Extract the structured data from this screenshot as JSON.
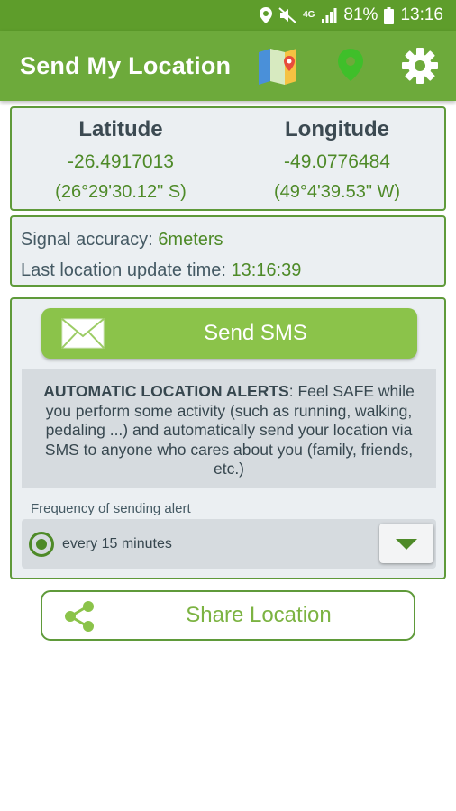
{
  "status_bar": {
    "network": "4G",
    "battery": "81%",
    "time": "13:16",
    "icons": [
      "location-icon",
      "mute-icon",
      "network-icon",
      "signal-icon",
      "battery-icon"
    ]
  },
  "app_bar": {
    "title": "Send My Location",
    "icons": [
      "map-icon",
      "location-pin-icon",
      "settings-gear-icon"
    ]
  },
  "coordinates": {
    "latitude": {
      "label": "Latitude",
      "decimal": "-26.4917013",
      "dms": "(26°29'30.12\" S)"
    },
    "longitude": {
      "label": "Longitude",
      "decimal": "-49.0776484",
      "dms": "(49°4'39.53\" W)"
    }
  },
  "info": {
    "accuracy_label": "Signal accuracy:",
    "accuracy_value": "6meters",
    "update_label": "Last location update time:",
    "update_value": "13:16:39"
  },
  "sms_button": {
    "label": "Send SMS",
    "icon": "envelope-icon"
  },
  "alerts": {
    "title": "AUTOMATIC LOCATION ALERTS",
    "text": ": Feel SAFE while you perform some activity (such as running, walking, pedaling ...) and automatically send your location via SMS to anyone who cares about you (family, friends, etc.)"
  },
  "frequency": {
    "label": "Frequency of sending alert",
    "selected": "every 15 minutes"
  },
  "share_button": {
    "label": "Share Location",
    "icon": "share-icon"
  },
  "colors": {
    "status_bar": "#5e9d2b",
    "app_bar": "#6daa3b",
    "accent_green": "#4e8a28",
    "sms_button": "#8bc34a",
    "share_text": "#7cb342",
    "card_bg": "#ebeff2"
  }
}
